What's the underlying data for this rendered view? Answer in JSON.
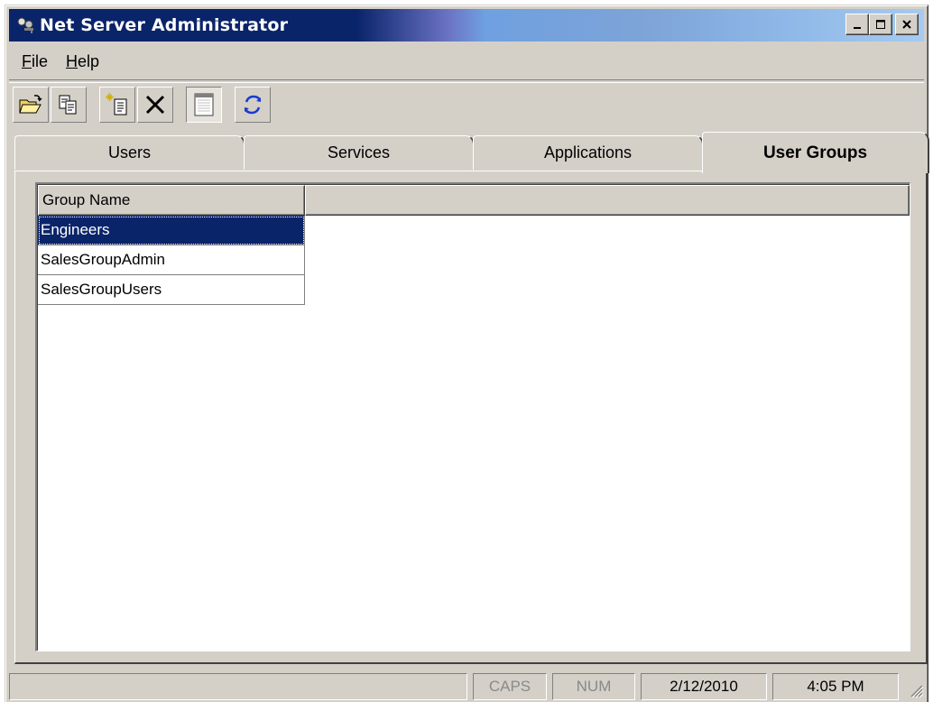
{
  "window": {
    "title": "Net Server Administrator",
    "icon": "network-key-icon"
  },
  "title_buttons": [
    "minimize",
    "maximize",
    "close"
  ],
  "menu": [
    {
      "label": "File"
    },
    {
      "label": "Help"
    }
  ],
  "toolbar": {
    "items": [
      "open-folder-icon",
      "copy-icon",
      "new-icon",
      "delete-icon",
      "window-icon",
      "refresh-icon"
    ]
  },
  "tabs": [
    {
      "label": "Users"
    },
    {
      "label": "Services"
    },
    {
      "label": "Applications"
    },
    {
      "label": "User Groups",
      "active": true
    }
  ],
  "list": {
    "columns": [
      "Group Name",
      ""
    ],
    "rows": [
      "Engineers",
      "SalesGroupAdmin",
      "SalesGroupUsers"
    ],
    "selected": "Engineers"
  },
  "status": {
    "message": "",
    "caps": "CAPS",
    "num": "NUM",
    "date": "2/12/2010",
    "time": "4:05 PM"
  },
  "colors": {
    "selection": "#0a246a",
    "face": "#d4d0c8",
    "title_start": "#0a246a",
    "title_end": "#a6caf0"
  }
}
